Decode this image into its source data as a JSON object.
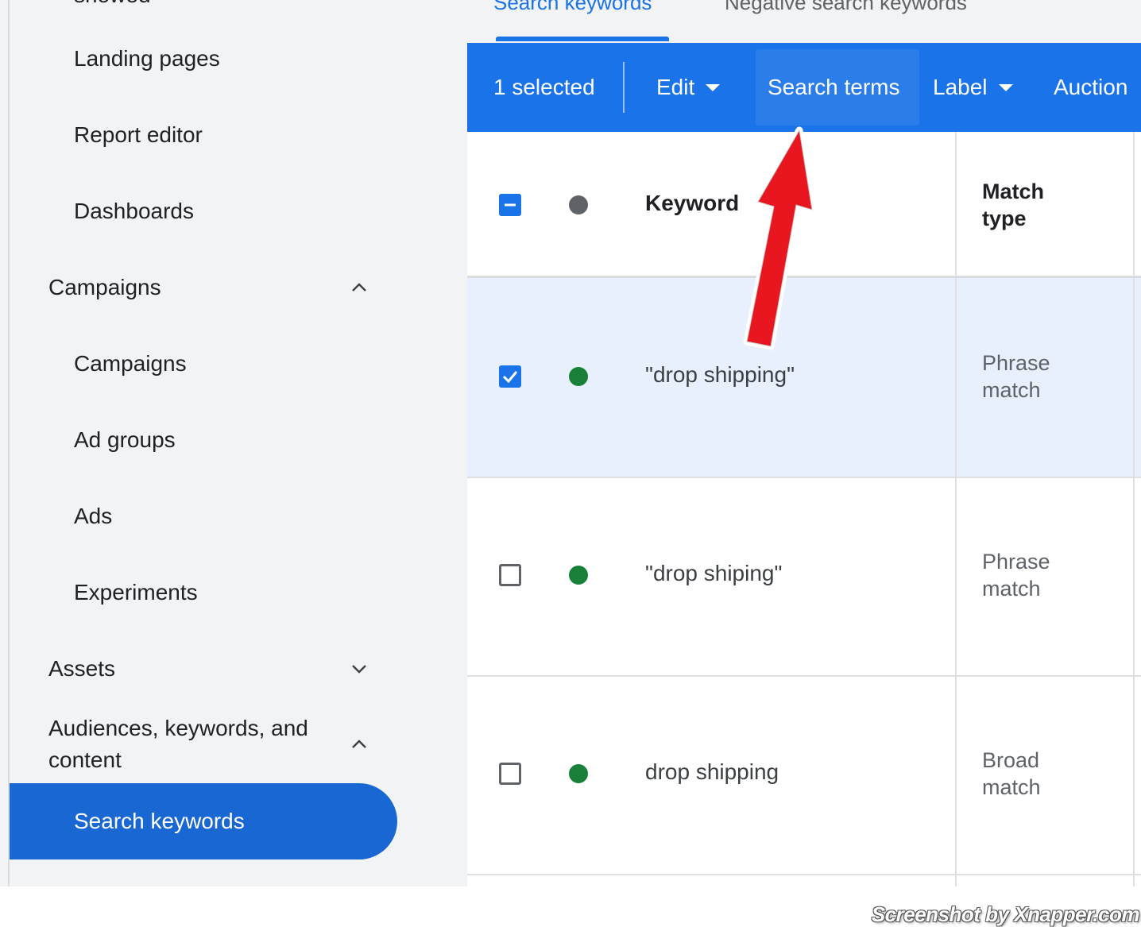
{
  "sidebar": {
    "partial_top_item": "showed",
    "items": [
      {
        "label": "Landing pages"
      },
      {
        "label": "Report editor"
      },
      {
        "label": "Dashboards"
      },
      {
        "label": "Campaigns",
        "chevron": "chevron-up-icon"
      },
      {
        "label": "Campaigns"
      },
      {
        "label": "Ad groups"
      },
      {
        "label": "Ads"
      },
      {
        "label": "Experiments"
      },
      {
        "label": "Assets",
        "chevron": "chevron-down-icon"
      },
      {
        "label": "Audiences, keywords, and content",
        "chevron": "chevron-up-icon"
      },
      {
        "label": "Search keywords",
        "active": true
      }
    ]
  },
  "tabs": [
    {
      "label": "Search keywords",
      "active": true
    },
    {
      "label": "Negative search keywords",
      "active": false
    }
  ],
  "toolbar": {
    "selected_count": "1 selected",
    "edit_label": "Edit",
    "search_terms_label": "Search terms",
    "label_label": "Label",
    "auction_label": "Auction"
  },
  "table": {
    "headers": {
      "keyword": "Keyword",
      "match_type": "Match type"
    },
    "rows": [
      {
        "keyword": "\"drop shipping\"",
        "match_type": "Phrase match",
        "checked": true,
        "status": "enabled"
      },
      {
        "keyword": "\"drop shiping\"",
        "match_type": "Phrase match",
        "checked": false,
        "status": "enabled"
      },
      {
        "keyword": "drop shipping",
        "match_type": "Broad match",
        "checked": false,
        "status": "enabled"
      }
    ]
  },
  "colors": {
    "accent": "#1a73e8",
    "active_nav": "#1967d2",
    "status_enabled": "#188038",
    "status_header": "#5f6368",
    "arrow": "#e8171f"
  },
  "watermark": "Screenshot by Xnapper.com"
}
